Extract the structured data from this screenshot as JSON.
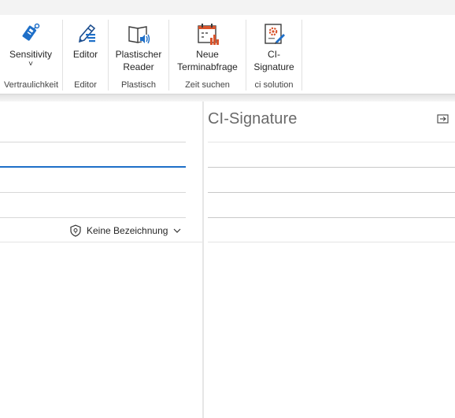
{
  "ribbon": {
    "groups": [
      {
        "label": "Vertraulichkeit",
        "buttons": [
          {
            "label": "Sensitivity",
            "sub": "˅"
          }
        ]
      },
      {
        "label": "Editor",
        "buttons": [
          {
            "label": "Editor"
          }
        ]
      },
      {
        "label": "Plastisch",
        "buttons": [
          {
            "label": "Plastischer",
            "label2": "Reader"
          }
        ]
      },
      {
        "label": "Zeit suchen",
        "buttons": [
          {
            "label": "Neue",
            "label2": "Terminabfrage"
          }
        ]
      },
      {
        "label": "ci solution",
        "buttons": [
          {
            "label": "CI-",
            "label2": "Signature"
          }
        ]
      }
    ]
  },
  "compose": {
    "sensitivity_label": "Keine Bezeichnung"
  },
  "side_pane": {
    "title": "CI-Signature"
  },
  "colors": {
    "accent": "#1e6fc8",
    "orange": "#d9542c"
  }
}
